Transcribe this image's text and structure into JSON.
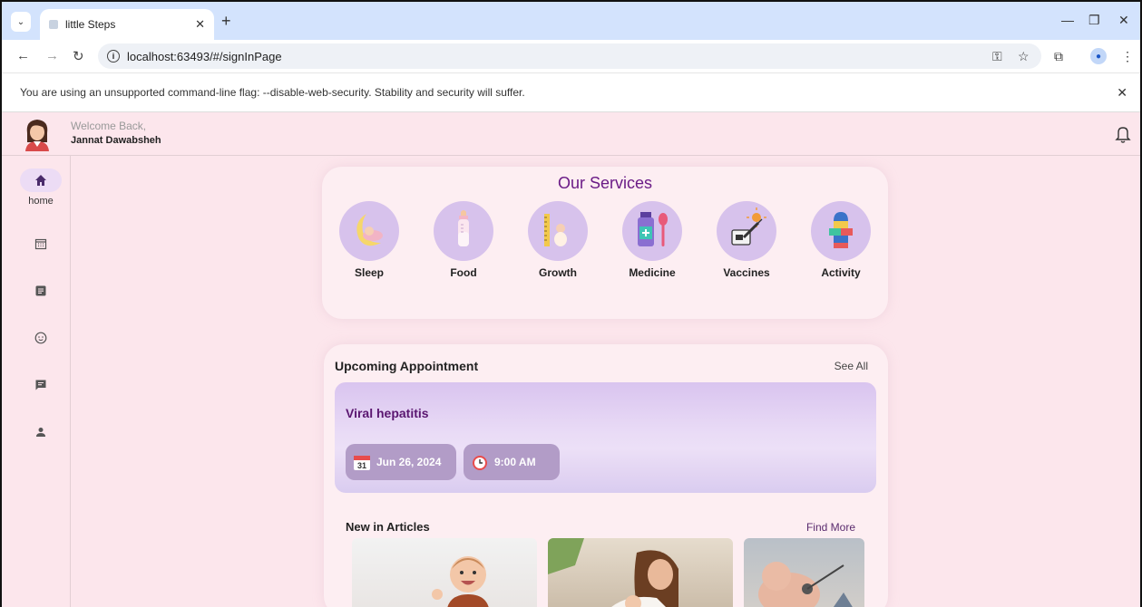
{
  "browser": {
    "tab_title": "little Steps",
    "url": "localhost:63493/#/signInPage",
    "warning": "You are using an unsupported command-line flag: --disable-web-security. Stability and security will suffer."
  },
  "header": {
    "welcome": "Welcome Back,",
    "username": "Jannat Dawabsheh"
  },
  "sidebar": {
    "items": [
      {
        "icon": "home-icon",
        "label": "home",
        "active": true
      },
      {
        "icon": "calendar-icon"
      },
      {
        "icon": "article-icon"
      },
      {
        "icon": "baby-face-icon"
      },
      {
        "icon": "chat-icon"
      },
      {
        "icon": "person-icon"
      }
    ]
  },
  "services": {
    "title": "Our Services",
    "items": [
      {
        "label": "Sleep",
        "icon": "sleep-icon"
      },
      {
        "label": "Food",
        "icon": "baby-bottle-icon"
      },
      {
        "label": "Growth",
        "icon": "growth-ruler-icon"
      },
      {
        "label": "Medicine",
        "icon": "medicine-icon"
      },
      {
        "label": "Vaccines",
        "icon": "vaccine-icon"
      },
      {
        "label": "Activity",
        "icon": "hopscotch-icon"
      }
    ]
  },
  "appointments": {
    "title": "Upcoming Appointment",
    "see_all": "See All",
    "name": "Viral hepatitis",
    "date": "Jun 26, 2024",
    "time": "9:00 AM"
  },
  "articles": {
    "title": "New in Articles",
    "find_more": "Find More"
  },
  "colors": {
    "app_bg": "#fce6ec",
    "accent": "#6a1b86",
    "chip": "#b29cc7",
    "service_circle": "#d7c2ec"
  }
}
